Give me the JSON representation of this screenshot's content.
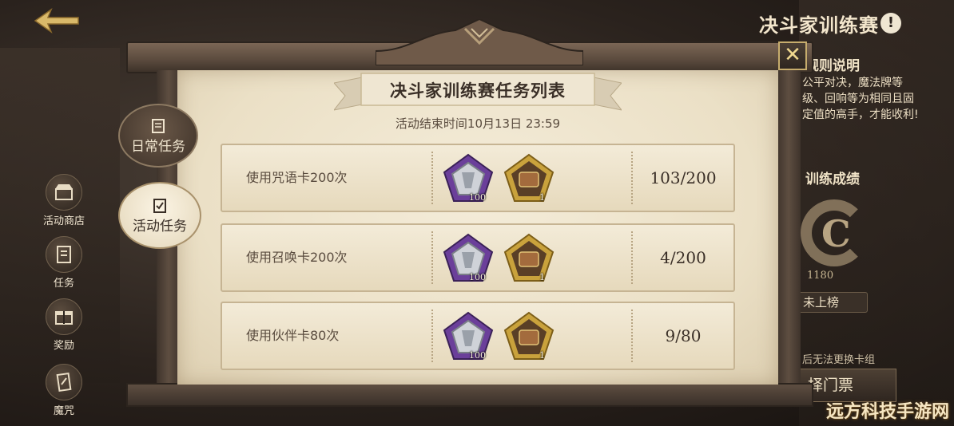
{
  "header": {
    "title": "决斗家训练赛",
    "info_icon": "!"
  },
  "right_panel": {
    "rules_heading": "规则说明",
    "rules_text": "公平对决，魔法牌等级、回响等为相同且固定值的高手，才能收利!",
    "record_heading": "训练成绩",
    "rank_letter": "C",
    "rank_score": "1180",
    "rank_status": "未上榜",
    "note": "后无法更换卡组",
    "ticket_button": "择门票"
  },
  "side_nav": [
    {
      "label": "活动商店",
      "icon": "shop-icon"
    },
    {
      "label": "任务",
      "icon": "task-icon"
    },
    {
      "label": "奖励",
      "icon": "reward-icon"
    },
    {
      "label": "魔咒",
      "icon": "spell-icon"
    }
  ],
  "tabs": [
    {
      "label": "日常任务",
      "selected": false
    },
    {
      "label": "活动任务",
      "selected": true
    }
  ],
  "panel": {
    "title": "决斗家训练赛任务列表",
    "deadline": "活动结束时间10月13日 23:59",
    "close_icon": "✕"
  },
  "tasks": [
    {
      "name": "使用咒语卡200次",
      "progress": "103/200",
      "rewards": [
        {
          "type": "silver-crest",
          "count": "100"
        },
        {
          "type": "gold-chest",
          "count": "1"
        }
      ]
    },
    {
      "name": "使用召唤卡200次",
      "progress": "4/200",
      "rewards": [
        {
          "type": "silver-crest",
          "count": "100"
        },
        {
          "type": "gold-chest",
          "count": "1"
        }
      ]
    },
    {
      "name": "使用伙伴卡80次",
      "progress": "9/80",
      "rewards": [
        {
          "type": "silver-crest",
          "count": "100"
        },
        {
          "type": "gold-chest",
          "count": "1"
        }
      ]
    }
  ],
  "watermark": "远方科技手游网",
  "colors": {
    "parchment": "#efe5cf",
    "frame": "#5a4a3d",
    "accent_gold": "#c7ad6d",
    "crest_purple": "#6b3f9a"
  }
}
